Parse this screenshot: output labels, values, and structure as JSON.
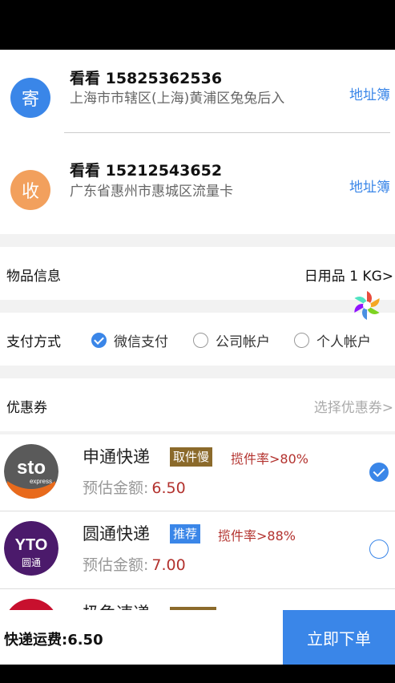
{
  "sender": {
    "badge": "寄",
    "name_phone": "看看 15825362536",
    "address": "上海市市辖区(上海)黄浦区兔兔后入",
    "address_book": "地址簿"
  },
  "receiver": {
    "badge": "收",
    "name_phone": "看看 15212543652",
    "address": "广东省惠州市惠城区流量卡",
    "address_book": "地址簿"
  },
  "goods": {
    "label": "物品信息",
    "value": "日用品 1 KG>"
  },
  "payment": {
    "label": "支付方式",
    "options": [
      {
        "label": "微信支付",
        "checked": true
      },
      {
        "label": "公司帐户",
        "checked": false
      },
      {
        "label": "个人帐户",
        "checked": false
      }
    ]
  },
  "coupon": {
    "label": "优惠券",
    "hint": "选择优惠券>"
  },
  "couriers": [
    {
      "name": "申通快递",
      "tag": "取件慢",
      "rate": "揽件率>80%",
      "est_label": "预估金额:",
      "price": "6.50",
      "selected": true,
      "logo_text": "sto",
      "logo_sub": "express"
    },
    {
      "name": "圆通快递",
      "tag": "推荐",
      "rate": "揽件率>88%",
      "est_label": "预估金额:",
      "price": "7.00",
      "selected": false,
      "logo_text": "YTO",
      "logo_sub": "圆通"
    },
    {
      "name": "极兔速递",
      "tag": "",
      "rate": "",
      "est_label": "",
      "price": "",
      "selected": false
    }
  ],
  "footer": {
    "fee_label": "快递运费:6.50",
    "order_button": "立即下单"
  },
  "colors": {
    "accent": "#3a86e8",
    "price_red": "#b3322e",
    "send_badge": "#3a86e8",
    "recv_badge": "#f2a05d"
  }
}
